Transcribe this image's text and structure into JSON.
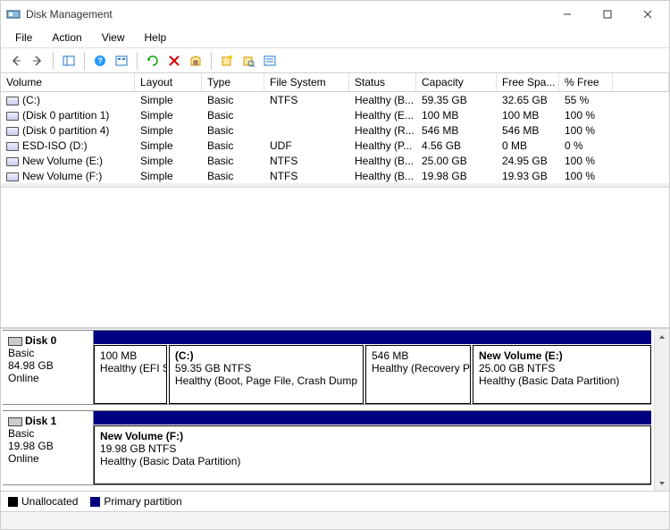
{
  "title": "Disk Management",
  "menu": [
    "File",
    "Action",
    "View",
    "Help"
  ],
  "columns": [
    "Volume",
    "Layout",
    "Type",
    "File System",
    "Status",
    "Capacity",
    "Free Spa...",
    "% Free"
  ],
  "volumes": [
    {
      "name": "(C:)",
      "layout": "Simple",
      "type": "Basic",
      "fs": "NTFS",
      "status": "Healthy (B...",
      "capacity": "59.35 GB",
      "free": "32.65 GB",
      "pct": "55 %"
    },
    {
      "name": "(Disk 0 partition 1)",
      "layout": "Simple",
      "type": "Basic",
      "fs": "",
      "status": "Healthy (E...",
      "capacity": "100 MB",
      "free": "100 MB",
      "pct": "100 %"
    },
    {
      "name": "(Disk 0 partition 4)",
      "layout": "Simple",
      "type": "Basic",
      "fs": "",
      "status": "Healthy (R...",
      "capacity": "546 MB",
      "free": "546 MB",
      "pct": "100 %"
    },
    {
      "name": "ESD-ISO (D:)",
      "layout": "Simple",
      "type": "Basic",
      "fs": "UDF",
      "status": "Healthy (P...",
      "capacity": "4.56 GB",
      "free": "0 MB",
      "pct": "0 %"
    },
    {
      "name": "New Volume (E:)",
      "layout": "Simple",
      "type": "Basic",
      "fs": "NTFS",
      "status": "Healthy (B...",
      "capacity": "25.00 GB",
      "free": "24.95 GB",
      "pct": "100 %"
    },
    {
      "name": "New Volume (F:)",
      "layout": "Simple",
      "type": "Basic",
      "fs": "NTFS",
      "status": "Healthy (B...",
      "capacity": "19.98 GB",
      "free": "19.93 GB",
      "pct": "100 %"
    }
  ],
  "disks": [
    {
      "name": "Disk 0",
      "type": "Basic",
      "size": "84.98 GB",
      "state": "Online",
      "parts": [
        {
          "title": "",
          "line2": "100 MB",
          "line3": "Healthy (EFI S",
          "flex": "0 0 82px"
        },
        {
          "title": "(C:)",
          "line2": "59.35 GB NTFS",
          "line3": "Healthy (Boot, Page File, Crash Dump",
          "flex": "1 1 210px"
        },
        {
          "title": "",
          "line2": "546 MB",
          "line3": "Healthy (Recovery P",
          "flex": "0 0 118px"
        },
        {
          "title": "New Volume  (E:)",
          "line2": "25.00 GB NTFS",
          "line3": "Healthy (Basic Data Partition)",
          "flex": "0 0 200px"
        }
      ]
    },
    {
      "name": "Disk 1",
      "type": "Basic",
      "size": "19.98 GB",
      "state": "Online",
      "parts": [
        {
          "title": "New Volume  (F:)",
          "line2": "19.98 GB NTFS",
          "line3": "Healthy (Basic Data Partition)",
          "flex": "1 1 auto"
        }
      ]
    }
  ],
  "legend": {
    "unallocated": "Unallocated",
    "primary": "Primary partition"
  },
  "colors": {
    "unallocated": "#000",
    "primary": "#000080"
  }
}
